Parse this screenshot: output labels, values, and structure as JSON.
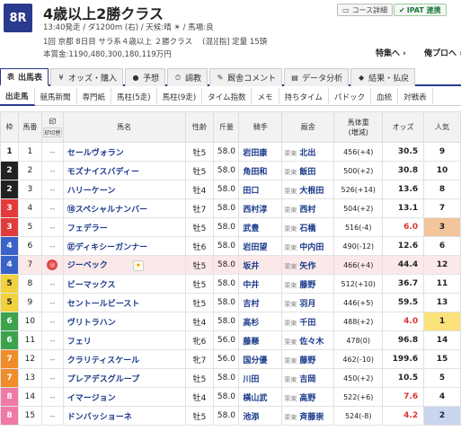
{
  "race": {
    "number": "8R",
    "title": "4歳以上2勝クラス",
    "line1": "13:40発走 / ダ1200m (右) / 天候:晴 ☀ / 馬場:良",
    "line2": "1回 京都 8日目 サラ系４歳以上 ２勝クラス　 (混)[指] 定量 15頭",
    "line3": "本賞金:1190,480,300,180,119万円"
  },
  "header_buttons": {
    "course": "コース詳細",
    "ipat": "IPAT 連携"
  },
  "header_links": {
    "special": "特集へ",
    "my_pro": "俺プロへ"
  },
  "tabs": [
    {
      "label": "出馬表",
      "icon": "表"
    },
    {
      "label": "オッズ・購入",
      "icon": "¥"
    },
    {
      "label": "予想",
      "icon": "●"
    },
    {
      "label": "調教",
      "icon": "⏱"
    },
    {
      "label": "厩舎コメント",
      "icon": "✎"
    },
    {
      "label": "データ分析",
      "icon": "▤"
    },
    {
      "label": "結果・払戻",
      "icon": "◆"
    }
  ],
  "subtabs": [
    "出走馬",
    "競馬新聞",
    "専門紙",
    "馬柱(5走)",
    "馬柱(9走)",
    "タイム指数",
    "メモ",
    "持ちタイム",
    "パドック",
    "血統",
    "対戦表"
  ],
  "columns": {
    "waku": "枠",
    "umaban": "馬番",
    "mark": "印",
    "mark_sub": "印切替",
    "name": "馬名",
    "sex_age": "性齢",
    "weight_carried": "斤量",
    "jockey": "騎手",
    "trainer": "厩舎",
    "body_weight": "馬体重",
    "body_weight_sub": "(増減)",
    "odds": "オッズ",
    "popularity": "人気"
  },
  "horses": [
    {
      "waku": "1",
      "umaban": "1",
      "mark": "--",
      "name": "セールヴォラン",
      "sex_age": "牡5",
      "kinryo": "58.0",
      "jockey": "岩田康",
      "region": "栗東",
      "trainer": "北出",
      "body": "456(+4)",
      "odds": "30.5",
      "pop": "9"
    },
    {
      "waku": "2",
      "umaban": "2",
      "mark": "--",
      "name": "モズナイスバディー",
      "sex_age": "牡5",
      "kinryo": "58.0",
      "jockey": "角田和",
      "region": "栗東",
      "trainer": "飯田",
      "body": "500(+2)",
      "odds": "30.8",
      "pop": "10"
    },
    {
      "waku": "2",
      "umaban": "3",
      "mark": "--",
      "name": "ハリーケーン",
      "sex_age": "牡4",
      "kinryo": "58.0",
      "jockey": "田口",
      "region": "栗東",
      "trainer": "大根田",
      "body": "526(+14)",
      "odds": "13.6",
      "pop": "8"
    },
    {
      "waku": "3",
      "umaban": "4",
      "mark": "--",
      "name": "⑱スペシャルナンバー",
      "sex_age": "牡7",
      "kinryo": "58.0",
      "jockey": "西村淳",
      "region": "栗東",
      "trainer": "西村",
      "body": "504(+2)",
      "odds": "13.1",
      "pop": "7"
    },
    {
      "waku": "3",
      "umaban": "5",
      "mark": "--",
      "name": "フェデラー",
      "sex_age": "牡5",
      "kinryo": "58.0",
      "jockey": "武豊",
      "region": "栗東",
      "trainer": "石橋",
      "body": "516(-4)",
      "odds": "6.0",
      "pop": "3"
    },
    {
      "waku": "4",
      "umaban": "6",
      "mark": "--",
      "name": "㊣ディキシーガンナー",
      "sex_age": "牡6",
      "kinryo": "58.0",
      "jockey": "岩田望",
      "region": "栗東",
      "trainer": "中内田",
      "body": "490(-12)",
      "odds": "12.6",
      "pop": "6"
    },
    {
      "waku": "4",
      "umaban": "7",
      "mark": "◎",
      "name": "ジーベック",
      "sex_age": "牡5",
      "kinryo": "58.0",
      "jockey": "坂井",
      "region": "栗東",
      "trainer": "矢作",
      "body": "466(+4)",
      "odds": "44.4",
      "pop": "12"
    },
    {
      "waku": "5",
      "umaban": "8",
      "mark": "--",
      "name": "ビーマックス",
      "sex_age": "牡5",
      "kinryo": "58.0",
      "jockey": "中井",
      "region": "栗東",
      "trainer": "藤野",
      "body": "512(+10)",
      "odds": "36.7",
      "pop": "11"
    },
    {
      "waku": "5",
      "umaban": "9",
      "mark": "--",
      "name": "セントールビースト",
      "sex_age": "牡5",
      "kinryo": "58.0",
      "jockey": "吉村",
      "region": "栗東",
      "trainer": "羽月",
      "body": "446(+5)",
      "odds": "59.5",
      "pop": "13"
    },
    {
      "waku": "6",
      "umaban": "10",
      "mark": "--",
      "name": "ヴリトラハン",
      "sex_age": "牡4",
      "kinryo": "58.0",
      "jockey": "高杉",
      "region": "栗東",
      "trainer": "千田",
      "body": "488(+2)",
      "odds": "4.0",
      "pop": "1"
    },
    {
      "waku": "6",
      "umaban": "11",
      "mark": "--",
      "name": "フェリ",
      "sex_age": "牝6",
      "kinryo": "56.0",
      "jockey": "藤懸",
      "region": "栗東",
      "trainer": "佐々木",
      "body": "478(0)",
      "odds": "96.8",
      "pop": "14"
    },
    {
      "waku": "7",
      "umaban": "12",
      "mark": "--",
      "name": "クラリティスケール",
      "sex_age": "牝7",
      "kinryo": "56.0",
      "jockey": "国分優",
      "region": "栗東",
      "trainer": "藤野",
      "body": "462(-10)",
      "odds": "199.6",
      "pop": "15"
    },
    {
      "waku": "7",
      "umaban": "13",
      "mark": "--",
      "name": "プレアデスグループ",
      "sex_age": "牡5",
      "kinryo": "58.0",
      "jockey": "川田",
      "region": "栗東",
      "trainer": "吉岡",
      "body": "450(+2)",
      "odds": "10.5",
      "pop": "5"
    },
    {
      "waku": "8",
      "umaban": "14",
      "mark": "--",
      "name": "イマージョン",
      "sex_age": "牡4",
      "kinryo": "58.0",
      "jockey": "横山武",
      "region": "栗東",
      "trainer": "高野",
      "body": "522(+6)",
      "odds": "7.6",
      "pop": "4"
    },
    {
      "waku": "8",
      "umaban": "15",
      "mark": "--",
      "name": "ドンバッショーネ",
      "sex_age": "牡5",
      "kinryo": "58.0",
      "jockey": "池添",
      "region": "栗東",
      "trainer": "斉藤崇",
      "body": "524(-8)",
      "odds": "4.2",
      "pop": "2"
    }
  ],
  "waku_colors": {
    "1": {
      "bg": "#ffffff",
      "fg": "#222222"
    },
    "2": {
      "bg": "#222222",
      "fg": "#ffffff"
    },
    "3": {
      "bg": "#e33b3b",
      "fg": "#ffffff"
    },
    "4": {
      "bg": "#3b62c9",
      "fg": "#ffffff"
    },
    "5": {
      "bg": "#f2d23c",
      "fg": "#222222"
    },
    "6": {
      "bg": "#3aa34b",
      "fg": "#ffffff"
    },
    "7": {
      "bg": "#f08c2a",
      "fg": "#ffffff"
    },
    "8": {
      "bg": "#f07aa6",
      "fg": "#ffffff"
    }
  },
  "accent_color": "#2a3a8c"
}
